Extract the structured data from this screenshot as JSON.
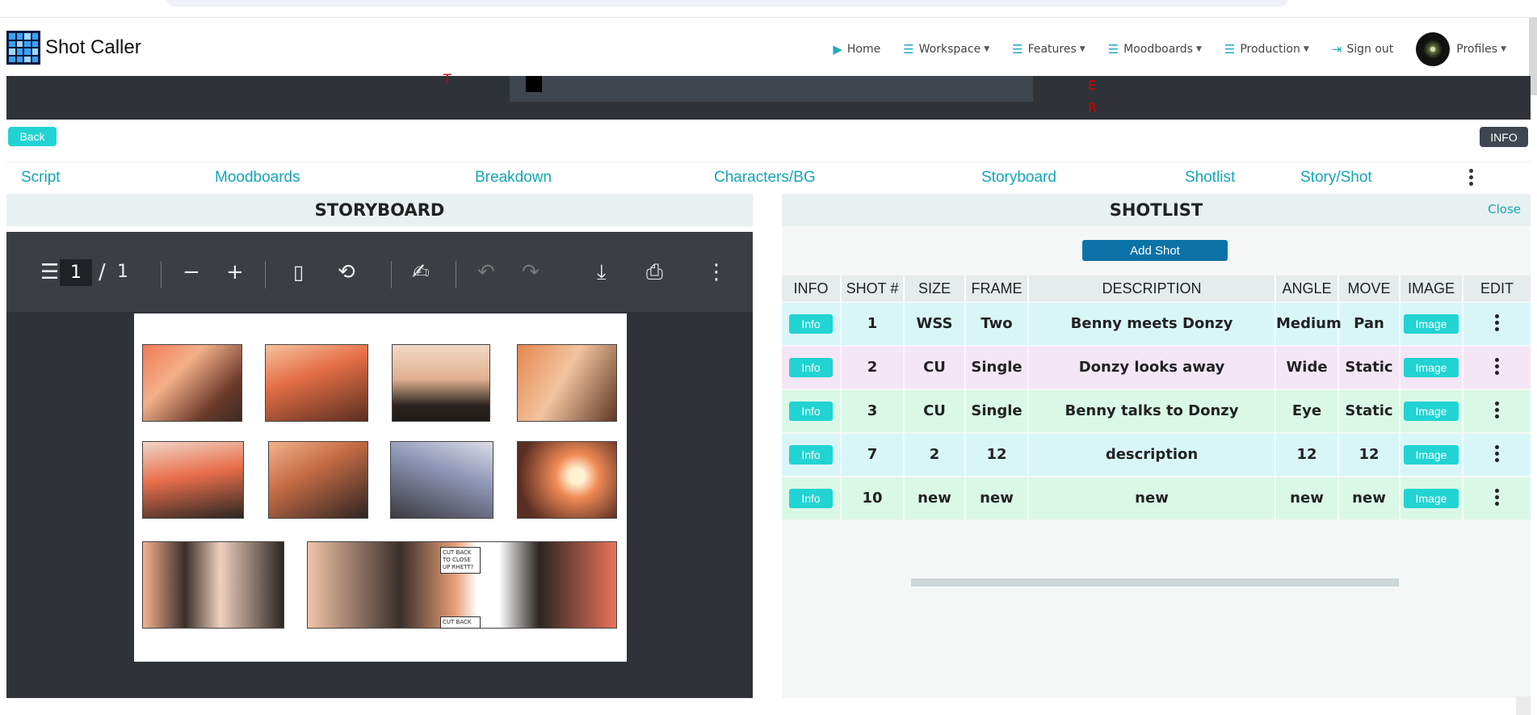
{
  "app": {
    "title": "Shot Caller"
  },
  "nav": {
    "items": [
      {
        "label": "Home",
        "icon": "play-icon",
        "dropdown": false
      },
      {
        "label": "Workspace",
        "icon": "menu-lines-icon",
        "dropdown": true
      },
      {
        "label": "Features",
        "icon": "menu-lines-icon",
        "dropdown": true
      },
      {
        "label": "Moodboards",
        "icon": "menu-lines-icon",
        "dropdown": true
      },
      {
        "label": "Production",
        "icon": "menu-lines-icon",
        "dropdown": true
      },
      {
        "label": "Sign out",
        "icon": "sign-out-icon",
        "dropdown": false
      },
      {
        "label": "Profiles",
        "icon": "avatar",
        "dropdown": true
      }
    ]
  },
  "banner": {
    "marks": [
      "T",
      "E",
      "R"
    ]
  },
  "actions": {
    "back": "Back",
    "info": "INFO"
  },
  "tabs": [
    "Script",
    "Moodboards",
    "Breakdown",
    "Characters/BG",
    "Storyboard",
    "Shotlist",
    "Story/Shot"
  ],
  "storyboard": {
    "title": "STORYBOARD",
    "viewer": {
      "current_page": "1",
      "separator": "/",
      "total_pages": "1"
    },
    "panel_notes": [
      "CUT BACK TO CLOSE UP RHETT?",
      "CUT BACK"
    ]
  },
  "shotlist": {
    "title": "SHOTLIST",
    "close_label": "Close",
    "add_shot_label": "Add Shot",
    "columns": [
      "INFO",
      "SHOT #",
      "SIZE",
      "FRAME",
      "DESCRIPTION",
      "ANGLE",
      "MOVE",
      "IMAGE",
      "EDIT"
    ],
    "info_label": "Info",
    "image_label": "Image",
    "rows": [
      {
        "shot": "1",
        "size": "WSS",
        "frame": "Two",
        "description": "Benny meets Donzy",
        "angle": "Medium",
        "move": "Pan",
        "bg": "#d8f6f8"
      },
      {
        "shot": "2",
        "size": "CU",
        "frame": "Single",
        "description": "Donzy looks away",
        "angle": "Wide",
        "move": "Static",
        "bg": "#f5e6f6"
      },
      {
        "shot": "3",
        "size": "CU",
        "frame": "Single",
        "description": "Benny talks to Donzy",
        "angle": "Eye",
        "move": "Static",
        "bg": "#d9f8e6"
      },
      {
        "shot": "7",
        "size": "2",
        "frame": "12",
        "description": "description",
        "angle": "12",
        "move": "12",
        "bg": "#d8f6f8"
      },
      {
        "shot": "10",
        "size": "new",
        "frame": "new",
        "description": "new",
        "angle": "new",
        "move": "new",
        "bg": "#d9f8e6"
      }
    ]
  },
  "colors": {
    "accent": "#22d3d3",
    "link": "#13a6b8",
    "add_button": "#0b72a8",
    "dark": "#2f3338"
  }
}
